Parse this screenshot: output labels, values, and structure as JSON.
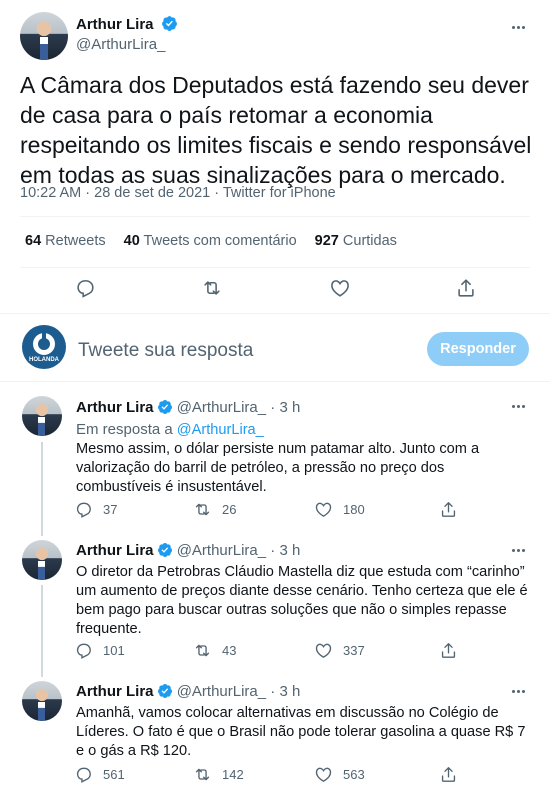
{
  "main_tweet": {
    "author_name": "Arthur Lira",
    "author_handle": "@ArthurLira_",
    "text": "A Câmara dos Deputados está fazendo seu dever de casa para o país retomar a economia respeitando os limites fiscais e sendo responsável em todas as suas sinalizações para o mercado.",
    "timestamp": "10:22 AM · 28 de set de 2021 · Twitter for iPhone",
    "stats": {
      "retweets_count": "64",
      "retweets_label": "Retweets",
      "quotes_count": "40",
      "quotes_label": "Tweets com comentário",
      "likes_count": "927",
      "likes_label": "Curtidas"
    }
  },
  "reply_box": {
    "placeholder": "Tweete sua resposta",
    "button_label": "Responder",
    "avatar_text": "HOLANDA"
  },
  "replies": [
    {
      "author_name": "Arthur Lira",
      "author_handle": "@ArthurLira_",
      "time": "· 3 h",
      "in_reply_prefix": "Em resposta a",
      "in_reply_handle": "@ArthurLira_",
      "text": "Mesmo assim, o dólar persiste num patamar alto. Junto com a valorização do barril de petróleo, a pressão no preço dos combustíveis é insustentável.",
      "replies": "37",
      "retweets": "26",
      "likes": "180"
    },
    {
      "author_name": "Arthur Lira",
      "author_handle": "@ArthurLira_",
      "time": "· 3 h",
      "text": "O diretor da Petrobras Cláudio Mastella diz que estuda com “carinho” um aumento de preços diante desse cenário. Tenho certeza que ele é bem pago para buscar outras soluções que não o simples repasse frequente.",
      "replies": "101",
      "retweets": "43",
      "likes": "337"
    },
    {
      "author_name": "Arthur Lira",
      "author_handle": "@ArthurLira_",
      "time": "· 3 h",
      "text": "Amanhã, vamos colocar alternativas em discussão no Colégio de Líderes. O fato é que o Brasil não pode tolerar gasolina a quase R$ 7 e o gás a R$ 120.",
      "replies": "561",
      "retweets": "142",
      "likes": "563"
    }
  ],
  "colors": {
    "accent": "#1d9bf0",
    "button_disabled": "#8ecdf7",
    "muted_text": "#536471",
    "divider": "#eff3f4"
  },
  "icons": [
    "verified-badge-icon",
    "more-options-icon",
    "reply-icon",
    "retweet-icon",
    "like-icon",
    "share-icon"
  ]
}
